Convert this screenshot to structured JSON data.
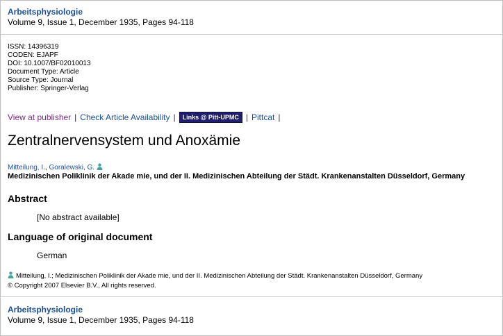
{
  "header": {
    "journal": "Arbeitsphysiologie",
    "volume_line": "Volume 9, Issue 1, December 1935, Pages 94-118"
  },
  "metadata": [
    "ISSN: 14396319",
    "CODEN: EJAPF",
    "DOI: 10.1007/BF02010013",
    "Document Type: Article",
    "Source Type: Journal",
    "Publisher: Springer-Verlag"
  ],
  "links": {
    "view_at_publisher": "View at publisher",
    "check_availability": "Check Article Availability",
    "pitt_upmc": "Links @ Pitt-UPMC",
    "pittcat": "Pittcat",
    "separator": "|"
  },
  "article": {
    "title": "Zentralnervensystem und Anoxämie",
    "author1": "Mitteilung, I.",
    "author2": "Goralewski, G.",
    "author_sep": ", ",
    "affiliation": "Medizinischen Poliklinik der Akade mie, und der II. Medizinischen Abteilung der Städt. Krankenanstalten Düsseldorf, Germany"
  },
  "abstract": {
    "heading": "Abstract",
    "text": "[No abstract available]"
  },
  "language": {
    "heading": "Language of original document",
    "value": "German"
  },
  "footer": {
    "correspondence": "Mitteilung, I.; Medizinischen Poliklinik der Akade mie, und der II. Medizinischen Abteilung der Städt. Krankenanstalten Düsseldorf, Germany",
    "copyright": "© Copyright 2007 Elsevier B.V., All rights reserved."
  },
  "colors": {
    "link": "#1a4f9c",
    "visited": "#7a2a82",
    "pitt_bg": "#1f1f6b",
    "person_icon": "#4aa39a"
  }
}
